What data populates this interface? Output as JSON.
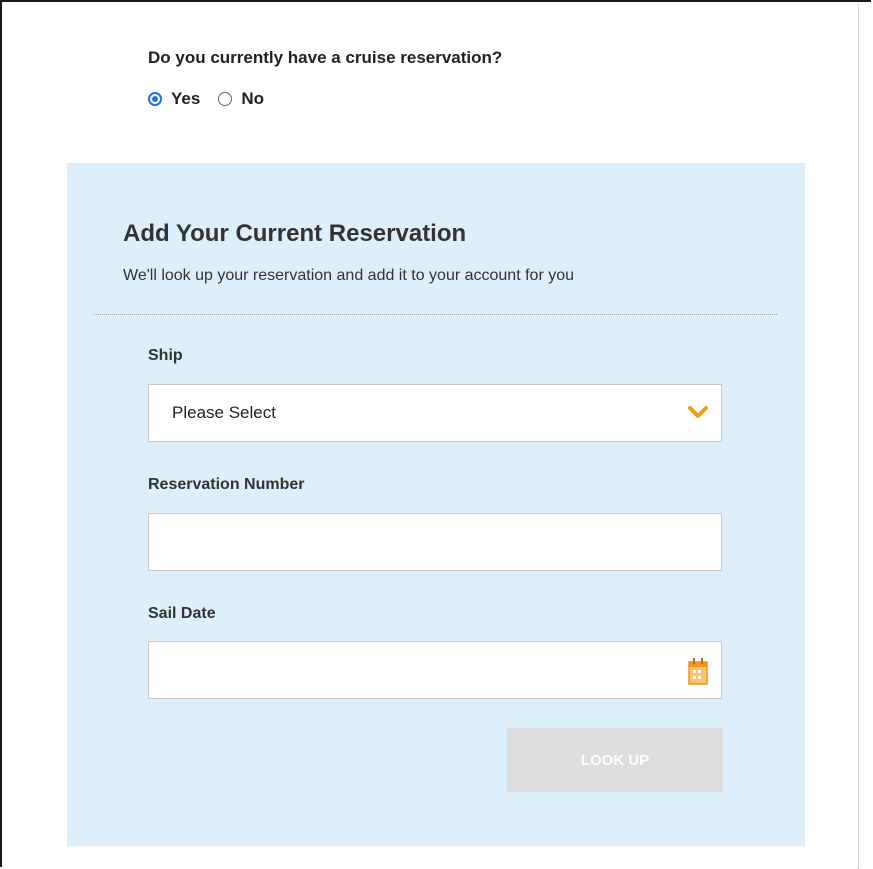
{
  "question": {
    "text": "Do you currently have a cruise reservation?",
    "options": [
      {
        "label": "Yes",
        "checked": true
      },
      {
        "label": "No",
        "checked": false
      }
    ]
  },
  "panel": {
    "title": "Add Your Current Reservation",
    "subtitle": "We'll look up your reservation and add it to your account for you",
    "ship": {
      "label": "Ship",
      "value": "Please Select",
      "icon": "chevron-down-icon"
    },
    "reservation_number": {
      "label": "Reservation Number",
      "value": ""
    },
    "sail_date": {
      "label": "Sail Date",
      "value": "",
      "icon": "calendar-icon"
    },
    "lookup_button": {
      "label": "LOOK UP",
      "disabled": true
    }
  },
  "colors": {
    "panel_bg": "#ddeffb",
    "accent_orange": "#f39c12",
    "radio_blue": "#1a73e8",
    "button_disabled": "#dddddd"
  }
}
